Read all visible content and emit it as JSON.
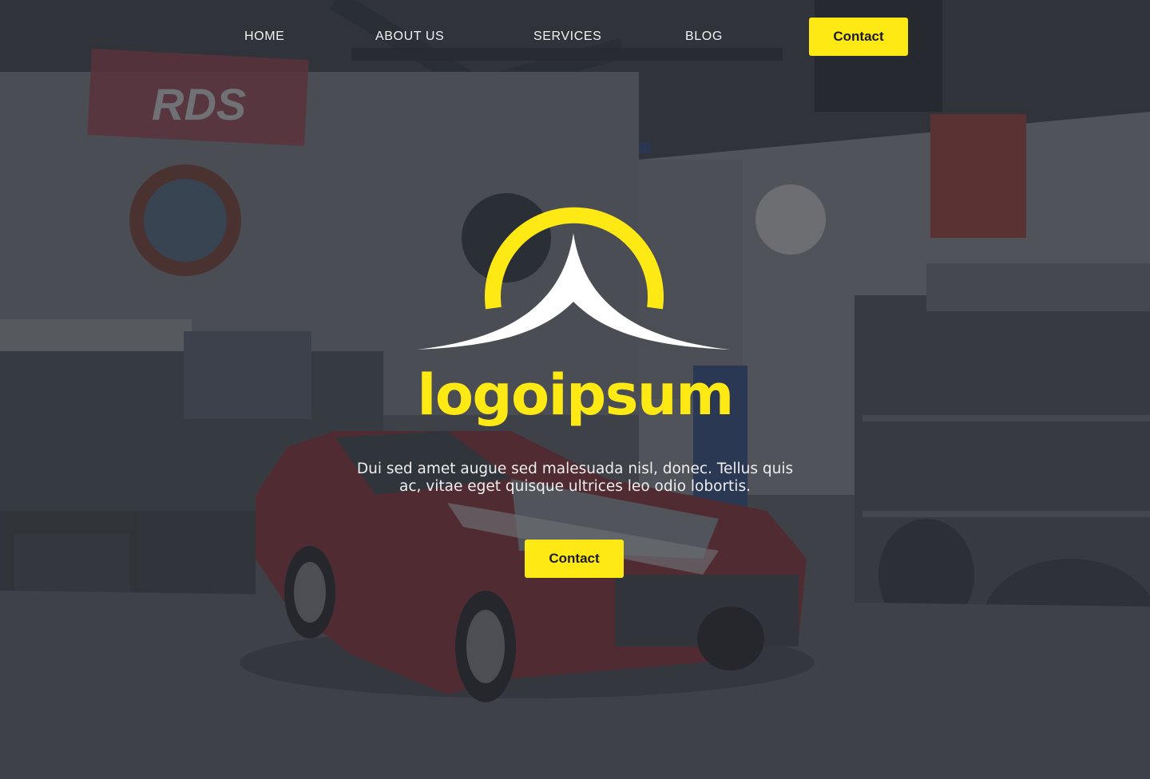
{
  "nav": {
    "links": [
      "HOME",
      "ABOUT US",
      "SERVICES",
      "BLOG"
    ],
    "cta_label": "Contact"
  },
  "hero": {
    "logo": {
      "wordmark": "logoipsum",
      "arc_color": "#ffe915",
      "peak_color": "#ffffff"
    },
    "tagline": "Dui sed amet augue sed malesuada nisl, donec. Tellus quis ac, vitae eget quisque ultrices leo odio lobortis.",
    "cta_label": "Contact",
    "background_image": "garage-with-red-classic-car",
    "overlay_color": "#2a2d33"
  },
  "colors": {
    "accent": "#ffe915",
    "button_text": "#1b1b1b",
    "nav_text": "#f2f2f2"
  }
}
